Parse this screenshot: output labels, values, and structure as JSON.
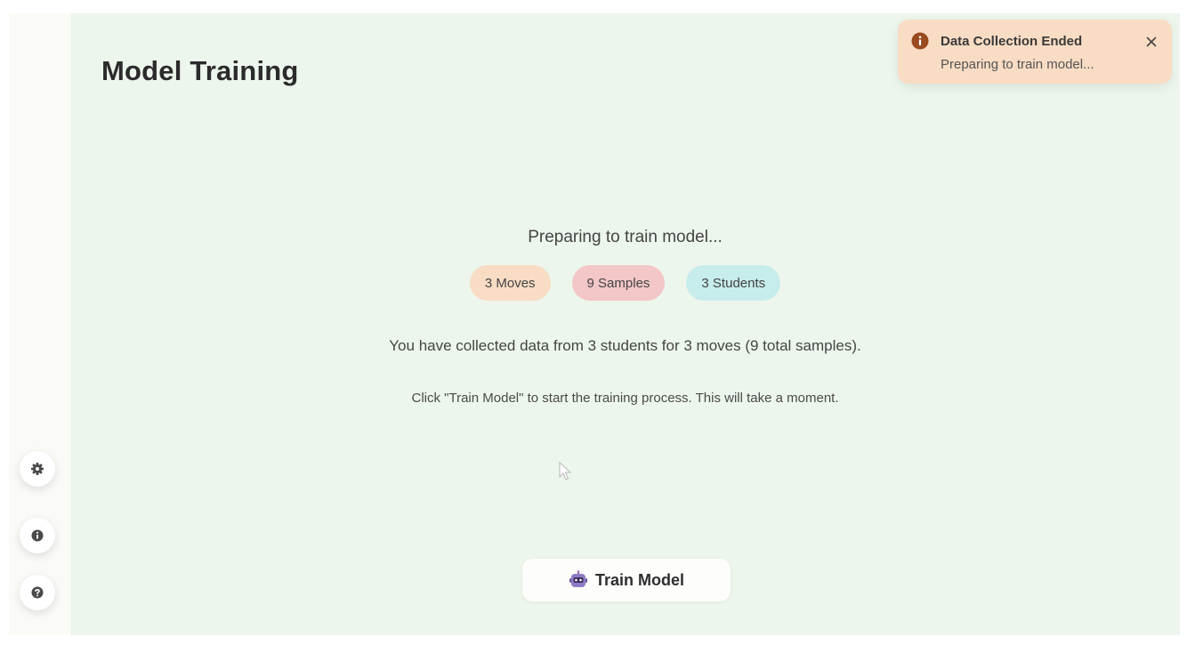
{
  "page": {
    "title": "Model Training"
  },
  "status": {
    "message": "Preparing to train model..."
  },
  "stats": {
    "moves": "3 Moves",
    "samples": "9 Samples",
    "students": "3 Students"
  },
  "summary": "You have collected data from 3 students for 3 moves (9 total samples).",
  "instruction": "Click \"Train Model\" to start the training process. This will take a moment.",
  "train_button": {
    "label": "Train Model",
    "icon": "robot-icon"
  },
  "toast": {
    "title": "Data Collection Ended",
    "message": "Preparing to train model...",
    "icon": "info-icon",
    "close_icon": "close-icon"
  },
  "sidebar": {
    "buttons": [
      {
        "icon": "gear-icon"
      },
      {
        "icon": "info-icon"
      },
      {
        "icon": "help-icon"
      }
    ]
  },
  "colors": {
    "main_background": "#edf6ec",
    "pill_moves": "#f8dcc4",
    "pill_samples": "#f3c7c7",
    "pill_students": "#c7ecec",
    "toast_background": "#f8dcc4",
    "toast_icon": "#9a4a1e"
  }
}
